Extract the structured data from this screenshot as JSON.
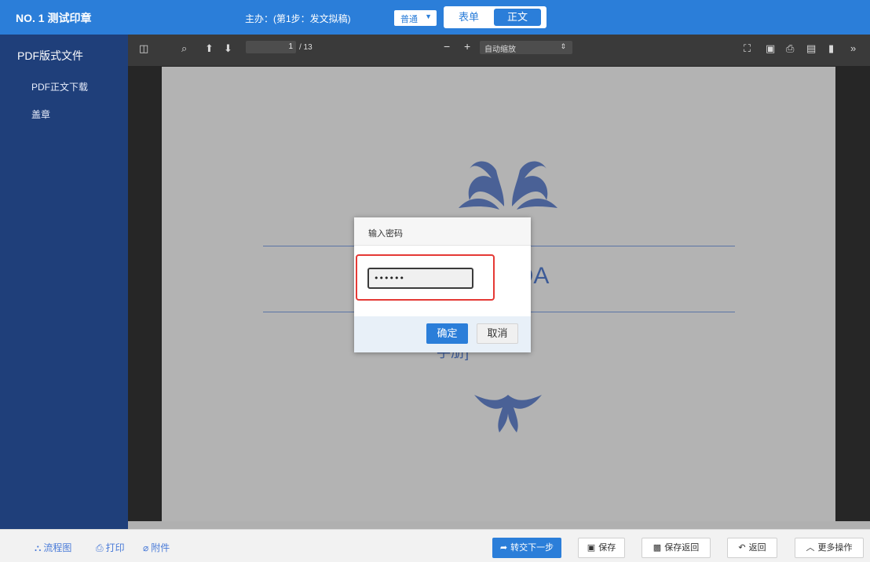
{
  "header": {
    "title": "NO. 1 测试印章",
    "step_info": "主办：(第1步：发文拟稿)",
    "mode_select": "普通",
    "tabs": [
      {
        "label": "表单"
      },
      {
        "label": "正文"
      }
    ]
  },
  "sidebar": {
    "title": "PDF版式文件",
    "items": [
      {
        "label": "PDF正文下载"
      },
      {
        "label": "盖章"
      }
    ]
  },
  "viewer": {
    "current_page": "1",
    "total_pages": "/ 13",
    "zoom": "自动缩放"
  },
  "document": {
    "title_partial": "OA",
    "subtitle_partial": "手册]"
  },
  "dialog": {
    "title": "输入密码",
    "password_value": "••••••",
    "ok_label": "确定",
    "cancel_label": "取消"
  },
  "bottom": {
    "links": [
      {
        "label": "流程图",
        "icon": "flowchart-icon"
      },
      {
        "label": "打印",
        "icon": "print-icon"
      },
      {
        "label": "附件",
        "icon": "paperclip-icon"
      }
    ],
    "buttons": [
      {
        "label": "转交下一步",
        "icon": "forward-icon"
      },
      {
        "label": "保存",
        "icon": "save-icon"
      },
      {
        "label": "保存返回",
        "icon": "save-return-icon"
      },
      {
        "label": "返回",
        "icon": "return-icon"
      },
      {
        "label": "更多操作",
        "icon": "chevron-up-icon"
      }
    ]
  },
  "colors": {
    "primary": "#2b7ed9",
    "sidebar": "#1f3f7a",
    "highlight": "#e53935"
  }
}
